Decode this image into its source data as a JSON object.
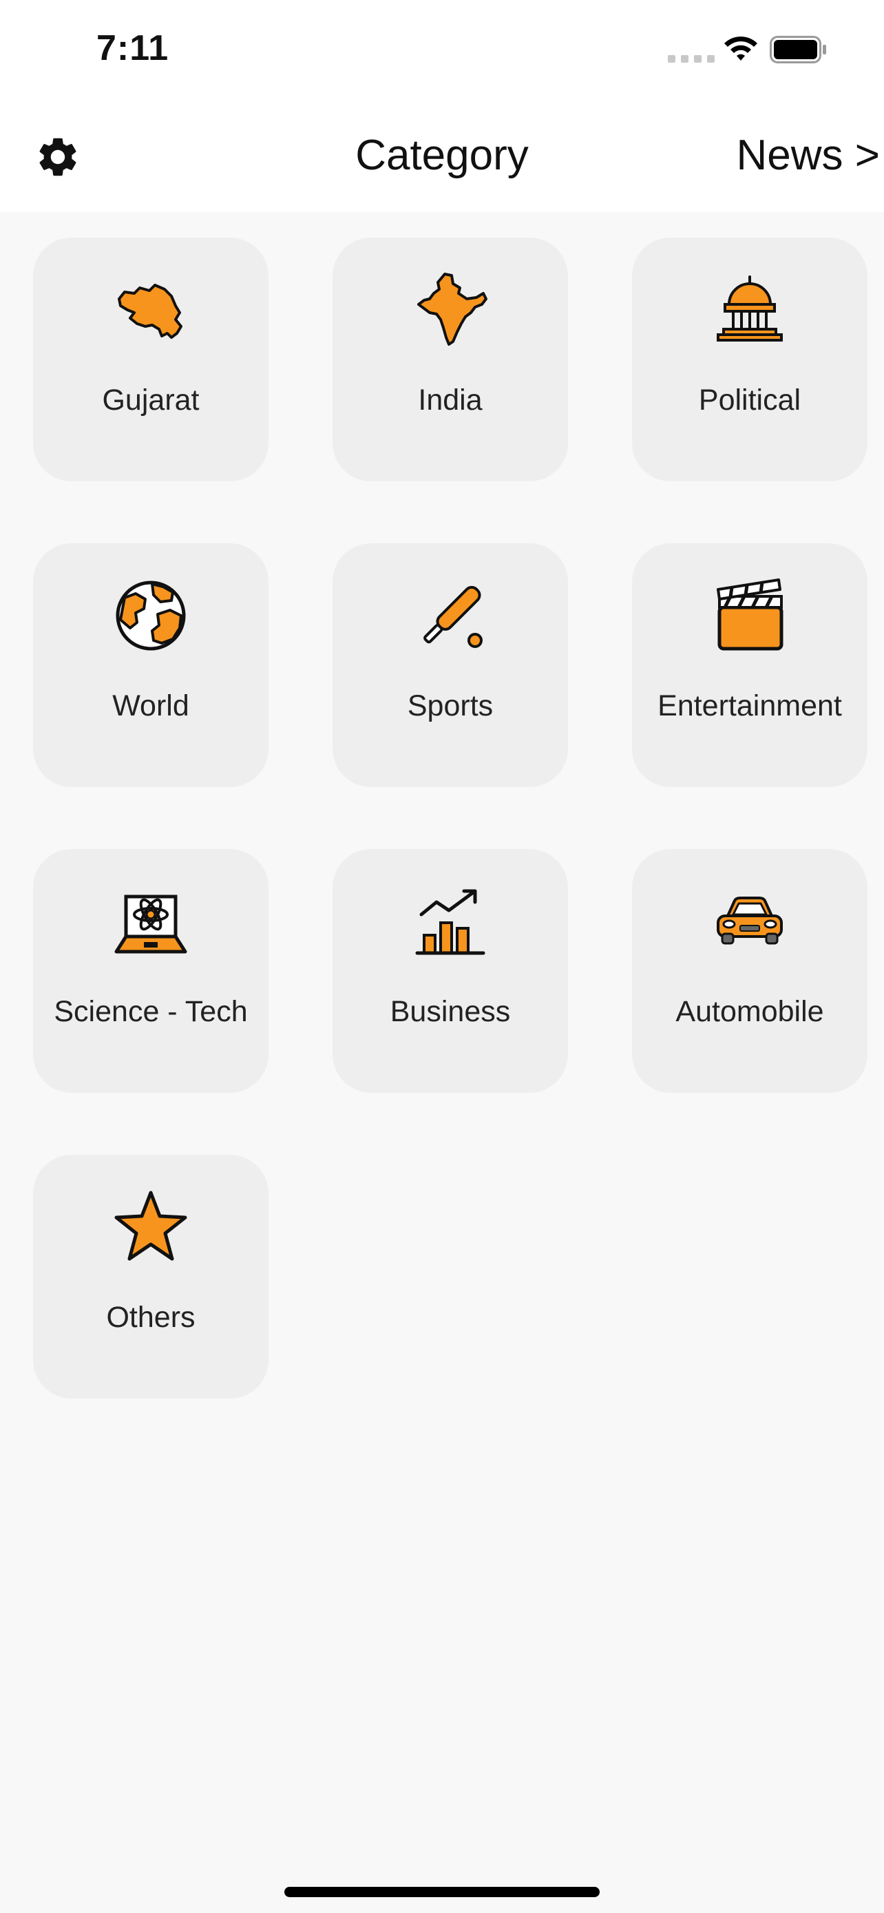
{
  "status_bar": {
    "time": "7:11"
  },
  "app_bar": {
    "title": "Category",
    "news_button": "News >"
  },
  "categories": [
    {
      "label": "Gujarat",
      "icon": "gujarat-map-icon"
    },
    {
      "label": "India",
      "icon": "india-map-icon"
    },
    {
      "label": "Political",
      "icon": "capitol-building-icon"
    },
    {
      "label": "World",
      "icon": "globe-icon"
    },
    {
      "label": "Sports",
      "icon": "cricket-bat-ball-icon"
    },
    {
      "label": "Entertainment",
      "icon": "clapperboard-icon"
    },
    {
      "label": "Science - Tech",
      "icon": "atom-laptop-icon"
    },
    {
      "label": "Business",
      "icon": "growth-chart-icon"
    },
    {
      "label": "Automobile",
      "icon": "car-icon"
    },
    {
      "label": "Others",
      "icon": "star-icon"
    }
  ],
  "colors": {
    "accent": "#F7941D",
    "tile_background": "#EEEEEE",
    "page_background": "#F8F8F8",
    "outline": "#111111"
  }
}
